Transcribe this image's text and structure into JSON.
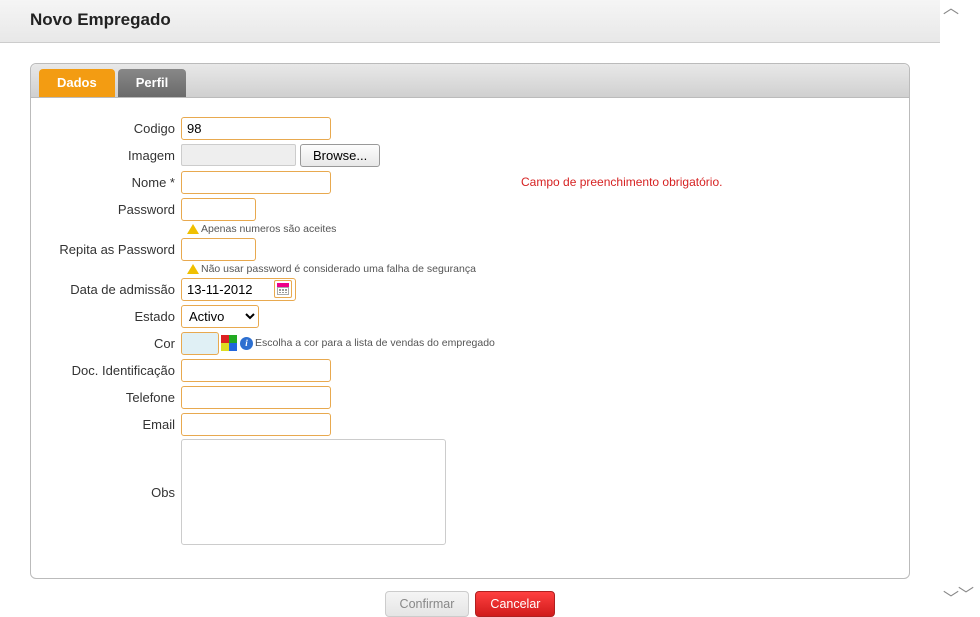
{
  "header": {
    "title": "Novo Empregado"
  },
  "tabs": [
    {
      "label": "Dados",
      "active": true
    },
    {
      "label": "Perfil",
      "active": false
    }
  ],
  "form": {
    "codigo": {
      "label": "Codigo",
      "value": "98"
    },
    "imagem": {
      "label": "Imagem",
      "browse_label": "Browse..."
    },
    "nome": {
      "label": "Nome *",
      "value": "",
      "error": "Campo de preenchimento obrigatório."
    },
    "password": {
      "label": "Password",
      "value": "",
      "hint": "Apenas numeros são aceites"
    },
    "repass": {
      "label": "Repita as Password",
      "value": "",
      "hint": "Não usar password é considerado uma falha de segurança"
    },
    "data_adm": {
      "label": "Data de admissão",
      "value": "13-11-2012"
    },
    "estado": {
      "label": "Estado",
      "value": "Activo"
    },
    "cor": {
      "label": "Cor",
      "value": "",
      "hint": "Escolha a cor para a lista de vendas do empregado"
    },
    "doc": {
      "label": "Doc. Identificação",
      "value": ""
    },
    "telefone": {
      "label": "Telefone",
      "value": ""
    },
    "email": {
      "label": "Email",
      "value": ""
    },
    "obs": {
      "label": "Obs",
      "value": ""
    }
  },
  "buttons": {
    "confirm": "Confirmar",
    "cancel": "Cancelar"
  }
}
